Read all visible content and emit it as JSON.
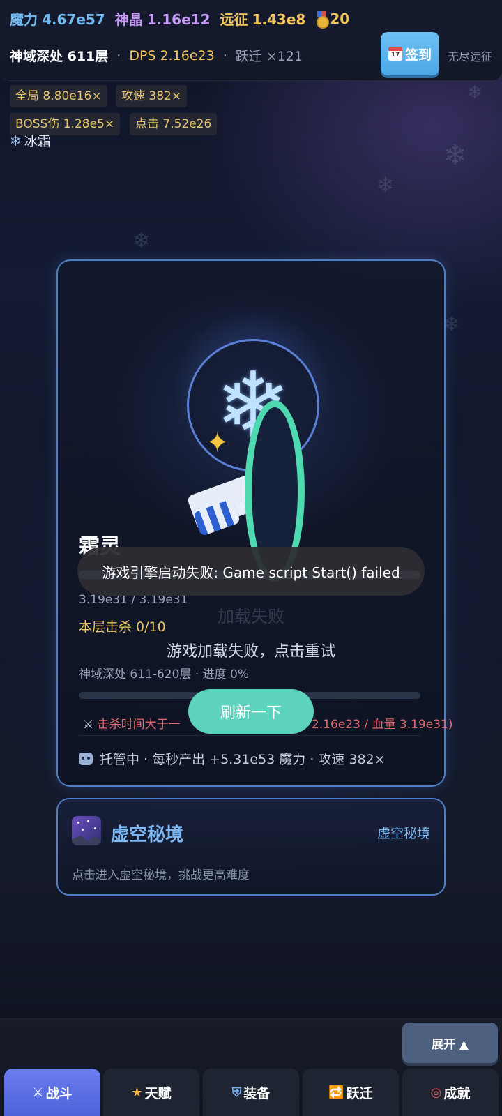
{
  "resources": {
    "mana_label": "魔力",
    "mana_value": "4.67e57",
    "crystal_label": "神晶",
    "crystal_value": "1.16e12",
    "expedition_label": "远征",
    "expedition_value": "1.43e8",
    "medal_count": "20"
  },
  "status": {
    "floor": "神域深处 611层",
    "dps": "DPS 2.16e23",
    "jump": "跃迁 ×121"
  },
  "signin": {
    "label": "签到",
    "calendar_day": "17"
  },
  "endless_label": "无尽远征",
  "buffs": [
    {
      "label": "全局 8.80e16×"
    },
    {
      "label": "攻速 382×"
    },
    {
      "label": "BOSS伤 1.28e5×"
    },
    {
      "label": "点击 7.52e26"
    }
  ],
  "element": "冰霜",
  "battle": {
    "boss_name": "霜灵",
    "hp_text": "3.19e31 / 3.19e31",
    "hp_fraction": 1.0,
    "loading_fail": "加载失败",
    "kills": "本层击杀 0/10",
    "retry_hint": "游戏加载失败，点击重试",
    "range": "神域深处 611-620层 · 进度 0%",
    "progress_fraction": 0,
    "warn_left": "击杀时间大于一",
    "warn_right": "2.16e23 / 血量 3.19e31)",
    "auto_text": "托管中 · 每秒产出 +5.31e53 魔力 · 攻速 382×"
  },
  "refresh_label": "刷新一下",
  "toast": "游戏引擎启动失败: Game script Start() failed",
  "void_realm": {
    "title": "虚空秘境",
    "link": "虚空秘境",
    "desc": "点击进入虚空秘境，挑战更高难度"
  },
  "expand_label": "展开 ▲",
  "nav": [
    {
      "label": "战斗",
      "icon": "swords-icon",
      "glyph": "⚔"
    },
    {
      "label": "天赋",
      "icon": "star-icon",
      "glyph": "★"
    },
    {
      "label": "装备",
      "icon": "shield-icon",
      "glyph": "⛨"
    },
    {
      "label": "跃迁",
      "icon": "repeat-icon",
      "glyph": "🔁"
    },
    {
      "label": "成就",
      "icon": "target-icon",
      "glyph": "◎"
    }
  ],
  "colors": {
    "mana": "#6fb8f0",
    "crystal": "#c59bf5",
    "gold": "#f3c55a",
    "panel_border": "#4f7fc7",
    "refresh": "#5dd3bd",
    "nav_active": "#5a6fe6",
    "warn": "#e0686a"
  }
}
